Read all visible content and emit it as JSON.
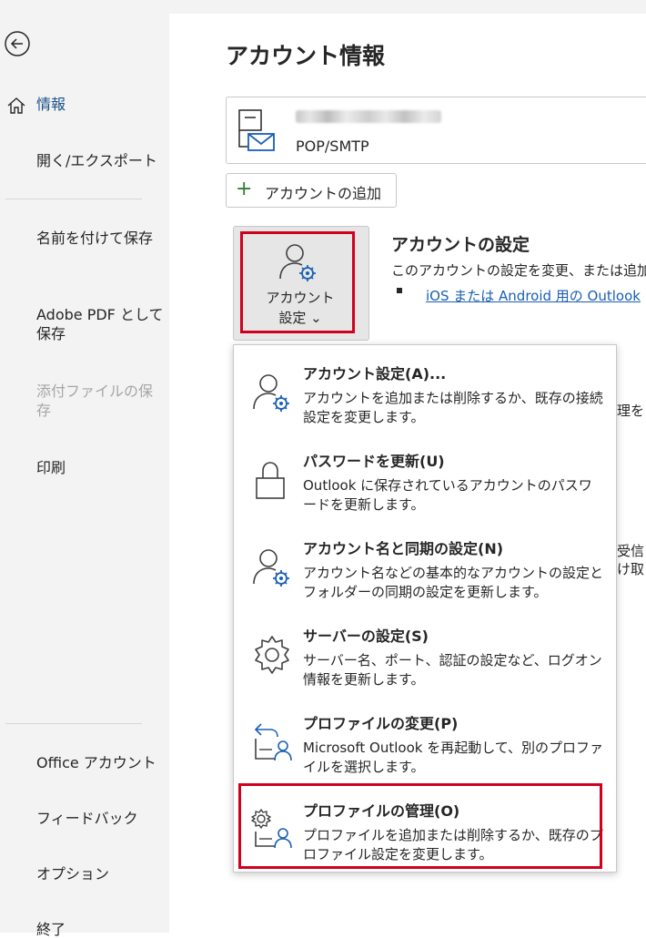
{
  "sidebar": {
    "back_label": "",
    "items": [
      {
        "label": "情報"
      },
      {
        "label": "開く/エクスポート"
      },
      {
        "label": "名前を付けて保存"
      },
      {
        "label": "Adobe PDF として保存"
      },
      {
        "label": "添付ファイルの保存"
      },
      {
        "label": "印刷"
      },
      {
        "label": "Office アカウント"
      },
      {
        "label": "フィードバック"
      },
      {
        "label": "オプション"
      },
      {
        "label": "終了"
      }
    ]
  },
  "main": {
    "title": "アカウント情報",
    "account": {
      "type": "POP/SMTP"
    },
    "add_account": {
      "label": "アカウントの追加"
    },
    "account_settings_button": {
      "line1": "アカウント",
      "line2": "設定 ⌄"
    },
    "section": {
      "title": "アカウントの設定",
      "description": "このアカウントの設定を変更、または追加",
      "link": "iOS または Android 用の Outlook"
    },
    "background_fragments": [
      "理を",
      "受信メ",
      "け取"
    ]
  },
  "menu": {
    "items": [
      {
        "title": "アカウント設定(A)...",
        "description": "アカウントを追加または削除するか、既存の接続設定を変更します。",
        "icon": "account-settings-icon"
      },
      {
        "title": "パスワードを更新(U)",
        "description": "Outlook に保存されているアカウントのパスワードを更新します。",
        "icon": "lock-icon"
      },
      {
        "title": "アカウント名と同期の設定(N)",
        "description": "アカウント名などの基本的なアカウントの設定とフォルダーの同期の設定を更新します。",
        "icon": "account-sync-settings-icon"
      },
      {
        "title": "サーバーの設定(S)",
        "description": "サーバー名、ポート、認証の設定など、ログオン情報を更新します。",
        "icon": "gear-icon"
      },
      {
        "title": "プロファイルの変更(P)",
        "description": "Microsoft Outlook を再起動して、別のプロファイルを選択します。",
        "icon": "change-profile-icon"
      },
      {
        "title": "プロファイルの管理(O)",
        "description": "プロファイルを追加または削除するか、既存のプロファイル設定を変更します。",
        "icon": "manage-profile-icon"
      }
    ]
  },
  "colors": {
    "accent": "#1a4f8a",
    "highlight": "#d1001f",
    "link": "#1a5fb4"
  }
}
